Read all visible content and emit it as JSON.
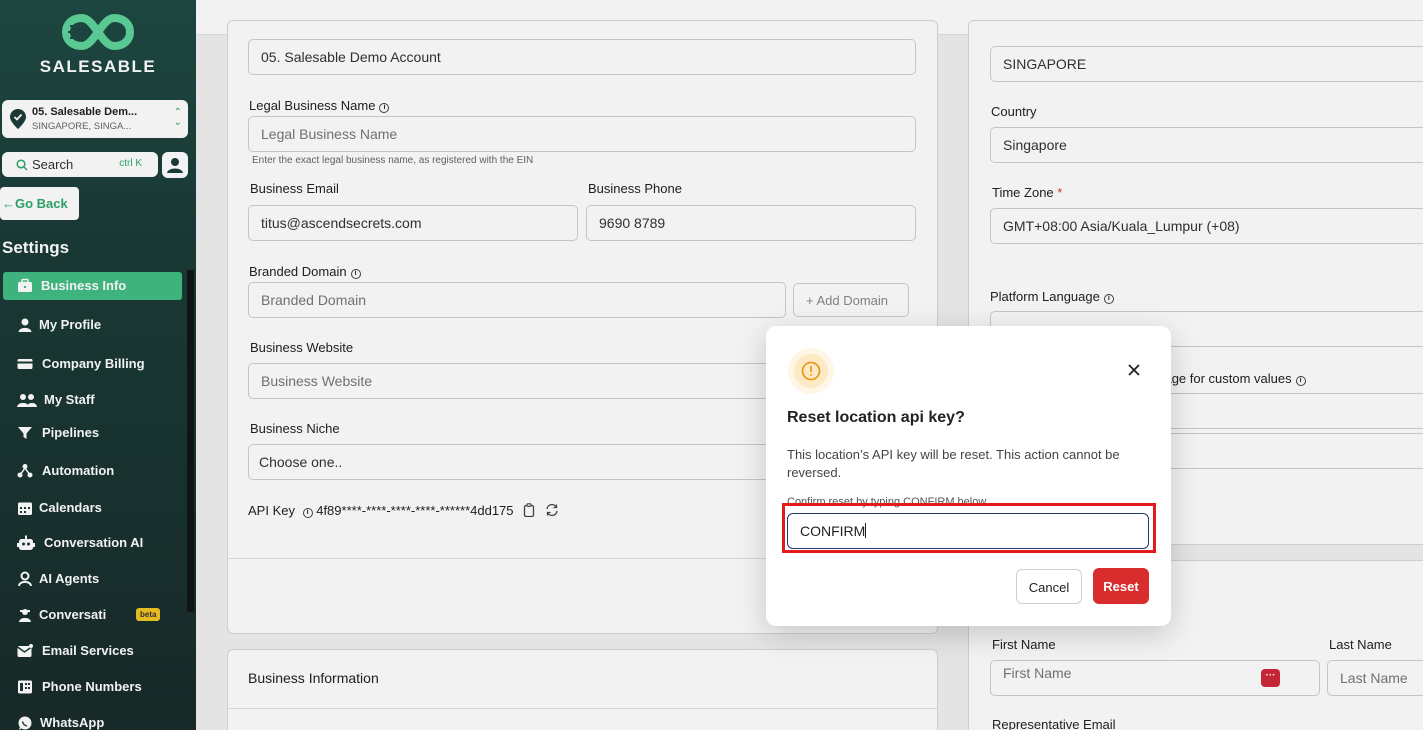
{
  "brand": {
    "name": "SALESABLE"
  },
  "location": {
    "name": "05. Salesable Dem...",
    "sub": "SINGAPORE, SINGA..."
  },
  "search": {
    "label": "Search",
    "shortcut": "ctrl K"
  },
  "nav": {
    "go_back": "Go Back",
    "settings_title": "Settings",
    "items": [
      {
        "label": "Business Info",
        "icon": "briefcase-icon"
      },
      {
        "label": "My Profile",
        "icon": "user-icon"
      },
      {
        "label": "Company Billing",
        "icon": "card-icon"
      },
      {
        "label": "My Staff",
        "icon": "users-icon"
      },
      {
        "label": "Pipelines",
        "icon": "funnel-icon"
      },
      {
        "label": "Automation",
        "icon": "automation-icon"
      },
      {
        "label": "Calendars",
        "icon": "calendar-icon"
      },
      {
        "label": "Conversation AI",
        "icon": "robot-icon"
      },
      {
        "label": "AI Agents",
        "icon": "agent-icon"
      },
      {
        "label": "Conversati",
        "icon": "chat-icon"
      },
      {
        "label": "Email Services",
        "icon": "mail-icon"
      },
      {
        "label": "Phone Numbers",
        "icon": "phone-icon"
      },
      {
        "label": "WhatsApp",
        "icon": "whatsapp-icon"
      }
    ],
    "beta": "beta"
  },
  "form": {
    "account_name_value": "05. Salesable Demo Account",
    "legal_name_label": "Legal Business Name",
    "legal_name_placeholder": "Legal Business Name",
    "legal_name_hint": "Enter the exact legal business name, as registered with the EIN",
    "email_label": "Business Email",
    "email_value": "titus@ascendsecrets.com",
    "phone_label": "Business Phone",
    "phone_value": "9690 8789",
    "domain_label": "Branded Domain",
    "domain_placeholder": "Branded Domain",
    "add_domain": "+ Add Domain",
    "website_label": "Business Website",
    "website_placeholder": "Business Website",
    "niche_label": "Business Niche",
    "niche_value": "Choose one..",
    "api_key_label": "API Key",
    "api_key_value": "4f89****-****-****-****-******4dd175",
    "business_information_title": "Business Information"
  },
  "right_panel": {
    "city_value": "SINGAPORE",
    "country_label": "Country",
    "country_value": "Singapore",
    "timezone_label": "Time Zone",
    "timezone_required": "*",
    "timezone_value": "GMT+08:00 Asia/Kuala_Lumpur (+08)",
    "platform_language_label": "Platform Language",
    "custom_values_label": "guage for custom values",
    "first_name_label": "First Name",
    "first_name_placeholder": "First Name",
    "last_name_label": "Last Name",
    "last_name_placeholder": "Last Name",
    "rep_email_label": "Representative Email"
  },
  "modal": {
    "title": "Reset location api key?",
    "description": "This location’s API key will be reset. This action cannot be reversed.",
    "confirm_label": "Confirm reset by typing CONFIRM below",
    "confirm_value": "CONFIRM",
    "cancel": "Cancel",
    "reset": "Reset"
  },
  "colors": {
    "accent": "#43bd84",
    "danger": "#d92d2d",
    "sidebar": "#1b3b37"
  }
}
